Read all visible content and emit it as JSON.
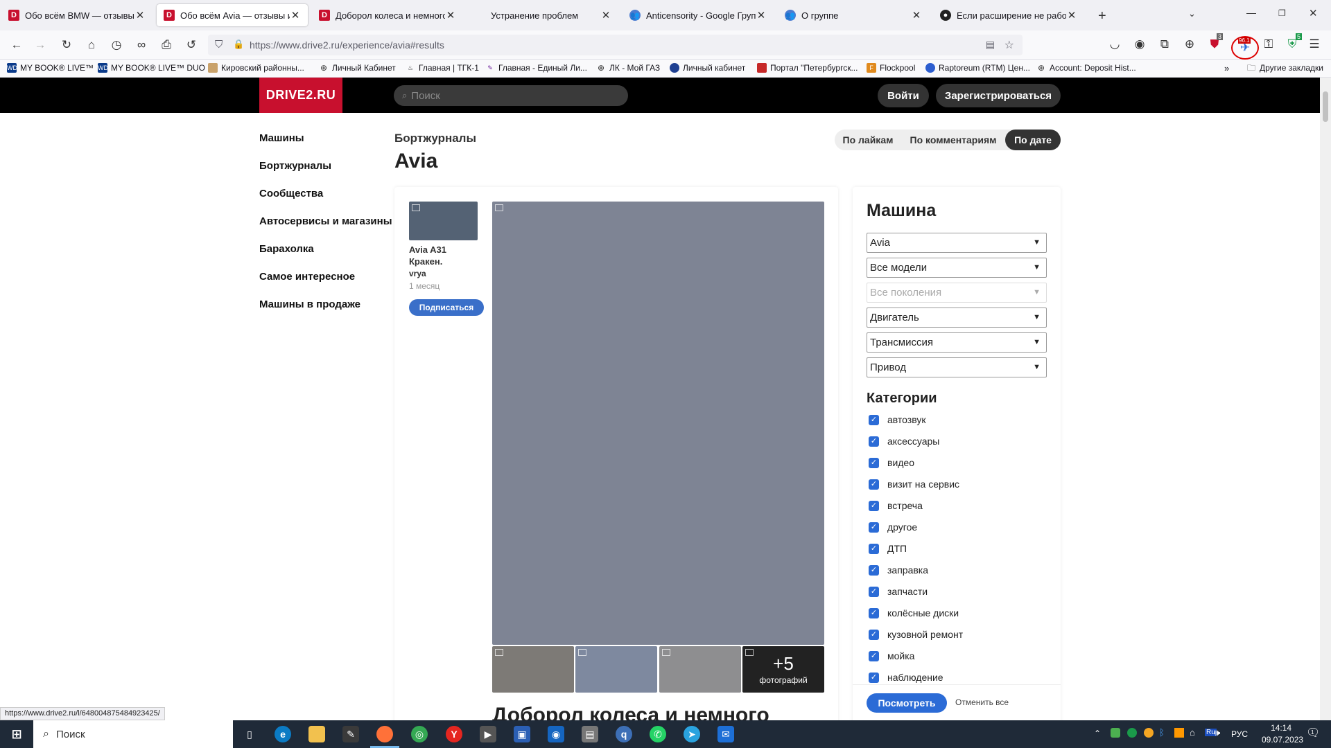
{
  "tabs": [
    {
      "label": "Обо всём BMW — отзывы и Б"
    },
    {
      "label": "Обо всём Avia — отзывы и Б"
    },
    {
      "label": "Доборол колеса и немного гр"
    },
    {
      "label": "Устранение проблем"
    },
    {
      "label": "Anticensority - Google Группы"
    },
    {
      "label": "О группе"
    },
    {
      "label": "Если расширение не работает"
    }
  ],
  "url": "https://www.drive2.ru/experience/avia#results",
  "bookmarks": [
    {
      "label": "MY BOOK® LIVE™"
    },
    {
      "label": "MY BOOK® LIVE™ DUO"
    },
    {
      "label": "Кировский районны..."
    },
    {
      "label": "Личный Кабинет"
    },
    {
      "label": "Главная | ТГК-1"
    },
    {
      "label": "Главная - Единый Ли..."
    },
    {
      "label": "ЛК - Мой ГАЗ"
    },
    {
      "label": "Личный кабинет"
    },
    {
      "label": "Портал \"Петербургск..."
    },
    {
      "label": "Flockpool"
    },
    {
      "label": "Raptoreum (RTM) Цен..."
    },
    {
      "label": "Account: Deposit Hist..."
    },
    {
      "label": "Другие закладки"
    }
  ],
  "site": {
    "logo": "DRIVE2.RU",
    "search_placeholder": "Поиск",
    "login": "Войти",
    "register": "Зарегистрироваться"
  },
  "left_nav": [
    "Машины",
    "Бортжурналы",
    "Сообщества",
    "Автосервисы и магазины",
    "Барахолка",
    "Самое интересное",
    "Машины в продаже"
  ],
  "page": {
    "section": "Бортжурналы",
    "title": "Avia",
    "sort": [
      "По лайкам",
      "По комментариям",
      "По дате"
    ]
  },
  "post": {
    "car": "Avia A31 Кракен.",
    "author": "vrya",
    "age": "1 месяц",
    "subscribe": "Подписаться",
    "more_count": "+5",
    "more_label": "фотографий",
    "headline": "Доборол колеса и немного"
  },
  "filter": {
    "title": "Машина",
    "selects": [
      "Avia",
      "Все модели",
      "Все поколения",
      "Двигатель",
      "Трансмиссия",
      "Привод"
    ],
    "categories_title": "Категории",
    "categories": [
      "автозвук",
      "аксессуары",
      "видео",
      "визит на сервис",
      "встреча",
      "другое",
      "ДТП",
      "заправка",
      "запчасти",
      "колёсные диски",
      "кузовной ремонт",
      "мойка",
      "наблюдение"
    ],
    "apply": "Посмотреть",
    "reset": "Отменить все"
  },
  "status_url": "https://www.drive2.ru/l/648004875484923425/",
  "taskbar": {
    "search": "Поиск",
    "lang": "РУС",
    "time": "14:14",
    "date": "09.07.2023",
    "notif": "1"
  },
  "extension_badges": [
    "3",
    "96.1",
    "5"
  ]
}
